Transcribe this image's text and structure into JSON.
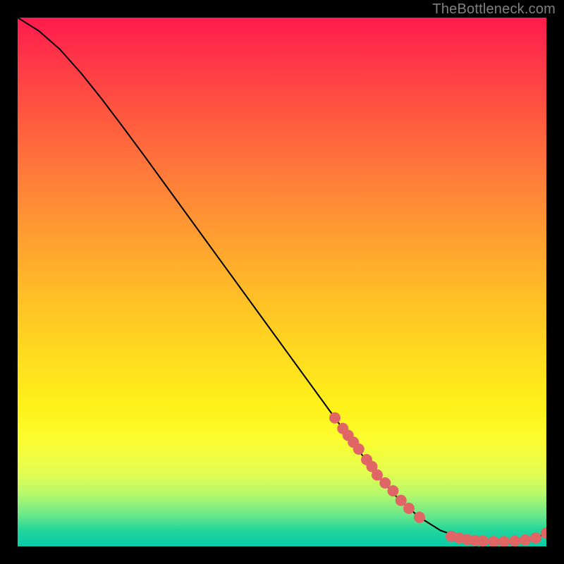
{
  "watermark": "TheBottleneck.com",
  "colors": {
    "background": "#000000",
    "marker": "#e06666",
    "curve": "#000000",
    "watermark_text": "#808080"
  },
  "chart_data": {
    "type": "line",
    "title": "",
    "xlabel": "",
    "ylabel": "",
    "xlim": [
      0,
      100
    ],
    "ylim": [
      0,
      100
    ],
    "curve": {
      "x": [
        0,
        4,
        8,
        12,
        16,
        20,
        24,
        28,
        32,
        36,
        40,
        44,
        48,
        52,
        56,
        60,
        64,
        68,
        72,
        76,
        80,
        84,
        86,
        88,
        90,
        92,
        94,
        96,
        98,
        100
      ],
      "y": [
        100,
        97.5,
        94,
        89.5,
        84.5,
        79.2,
        73.8,
        68.3,
        62.8,
        57.3,
        51.8,
        46.3,
        40.8,
        35.3,
        29.8,
        24.3,
        18.8,
        13.5,
        9.0,
        5.5,
        3.0,
        1.6,
        1.2,
        1.0,
        0.9,
        0.9,
        1.0,
        1.2,
        1.6,
        2.5
      ]
    },
    "markers": {
      "x": [
        60,
        61.5,
        62.5,
        63.5,
        64.5,
        66,
        67,
        68,
        69.5,
        71,
        72.5,
        74,
        76,
        82,
        83.5,
        85,
        86.5,
        88,
        90,
        92,
        94,
        96,
        98,
        100
      ],
      "y": [
        24.3,
        22.3,
        21.0,
        19.7,
        18.4,
        16.4,
        15.1,
        13.5,
        12.0,
        10.5,
        8.7,
        7.2,
        5.5,
        1.9,
        1.6,
        1.3,
        1.1,
        1.0,
        0.9,
        0.9,
        1.0,
        1.2,
        1.6,
        2.5
      ]
    }
  }
}
